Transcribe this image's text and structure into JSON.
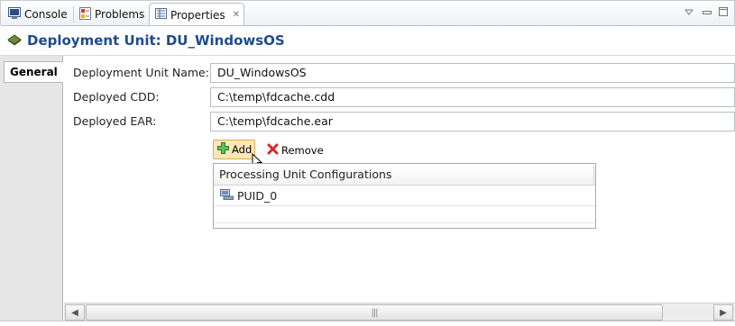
{
  "tabs": [
    {
      "label": "Console",
      "icon": "console-icon",
      "active": false
    },
    {
      "label": "Problems",
      "icon": "problems-icon",
      "active": false
    },
    {
      "label": "Properties",
      "icon": "properties-icon",
      "active": true
    }
  ],
  "window_controls": [
    "view-menu-icon",
    "minimize-icon",
    "maximize-icon"
  ],
  "title": "Deployment Unit: DU_WindowsOS",
  "side_tabs": [
    {
      "label": "General"
    }
  ],
  "form": {
    "fields": [
      {
        "label": "Deployment Unit Name:",
        "value": "DU_WindowsOS"
      },
      {
        "label": "Deployed CDD:",
        "value": "C:\\temp\\fdcache.cdd"
      },
      {
        "label": "Deployed EAR:",
        "value": "C:\\temp\\fdcache.ear"
      }
    ]
  },
  "toolbar": {
    "add_label": "Add",
    "remove_label": "Remove"
  },
  "table": {
    "header": "Processing Unit Configurations",
    "rows": [
      {
        "label": "PUID_0"
      }
    ]
  },
  "colors": {
    "title": "#1f4b8f",
    "add_button_bg": "#fde7b8",
    "remove_icon": "#d62828",
    "add_icon": "#3aa53a"
  }
}
